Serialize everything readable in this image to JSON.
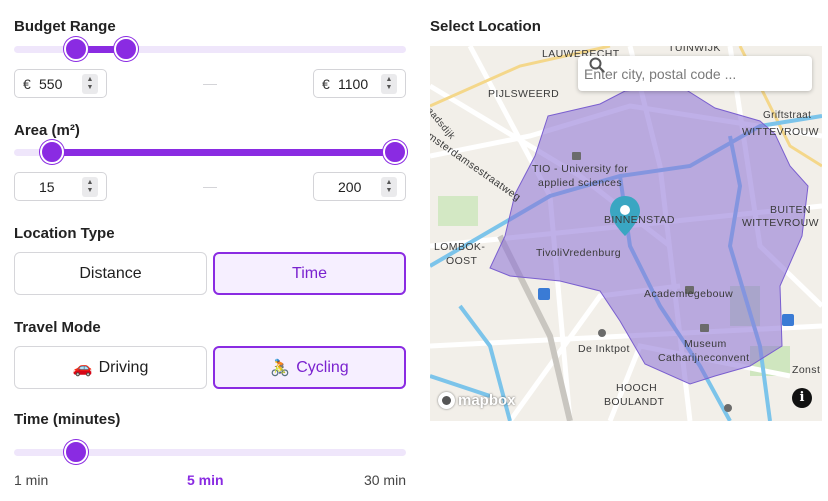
{
  "budget": {
    "label": "Budget Range",
    "currency": "€",
    "min_value": "550",
    "max_value": "1100",
    "range_min_fraction": 0.16,
    "range_max_fraction": 0.29
  },
  "area": {
    "label": "Area (m²)",
    "min_value": "15",
    "max_value": "200",
    "range_min_fraction": 0.0,
    "range_max_fraction": 1.0
  },
  "location_type": {
    "label": "Location Type",
    "options": [
      {
        "label": "Distance",
        "active": false
      },
      {
        "label": "Time",
        "active": true
      }
    ]
  },
  "travel_mode": {
    "label": "Travel Mode",
    "options": [
      {
        "emoji": "🚗",
        "label": "Driving",
        "active": false
      },
      {
        "emoji": "🚴",
        "label": "Cycling",
        "active": true
      }
    ]
  },
  "time": {
    "label": "Time (minutes)",
    "value_fraction": 0.16,
    "min_label": "1 min",
    "current_label": "5 min",
    "max_label": "30 min"
  },
  "map": {
    "title": "Select Location",
    "search_placeholder": "Enter city, postal code ...",
    "labels": {
      "lauwerecht": "LAUWERECHT",
      "tuinwijk": "TUINWIJK",
      "pijlsweerd": "PIJLSWEERD",
      "amsterdamsestraatweg": "Amsterdamsestraatweg",
      "griftstraat": "Griftstraat",
      "wittevrouwen": "WITTEVROUW",
      "tio": "TIO - University for",
      "tio2": "applied sciences",
      "binnenstad": "BINNENSTAD",
      "buiten": "BUITEN",
      "wittevrouwen2": "WITTEVROUW",
      "lombok": "LOMBOK-",
      "oost": "OOST",
      "tivoli": "TivoliVredenburg",
      "academiegebouw": "Academiegebouw",
      "museum": "Museum",
      "catharijneconvent": "Catharijneconvent",
      "inktpot": "De Inktpot",
      "hooch": "HOOCH",
      "boulandt": "BOULANDT",
      "zonst": "Zonst",
      "stadsweg": "Raadsdijk"
    },
    "attribution": "mapbox",
    "info_symbol": "i",
    "colors": {
      "accent": "#8a2be2",
      "isochrone": "#8a6fd6",
      "water": "#7cc4ea",
      "marker": "#3aa6c2"
    }
  }
}
